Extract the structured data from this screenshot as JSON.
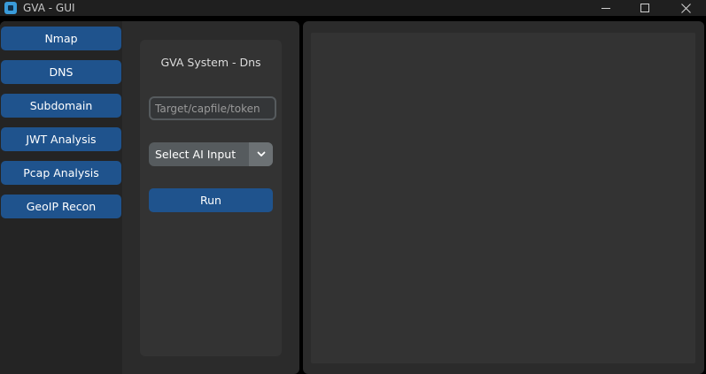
{
  "window": {
    "title": "GVA - GUI"
  },
  "sidebar": {
    "items": [
      {
        "label": "Nmap"
      },
      {
        "label": "DNS"
      },
      {
        "label": "Subdomain"
      },
      {
        "label": "JWT Analysis"
      },
      {
        "label": "Pcap Analysis"
      },
      {
        "label": "GeoIP Recon"
      }
    ]
  },
  "panel": {
    "title": "GVA System - Dns",
    "target_input": {
      "value": "",
      "placeholder": "Target/capfile/token"
    },
    "ai_select": {
      "selected": "Select AI Input"
    },
    "run_label": "Run"
  },
  "output": {
    "text": ""
  },
  "colors": {
    "accent": "#1f538d",
    "sidebar_bg": "#242424",
    "frame_bg": "#2b2b2b",
    "panel_bg": "#333333",
    "dropdown_bg": "#565b5e"
  },
  "icons": {
    "app": "app-icon",
    "minimize": "minimize-icon",
    "maximize": "maximize-icon",
    "close": "close-icon",
    "dropdown": "chevron-down-icon"
  }
}
